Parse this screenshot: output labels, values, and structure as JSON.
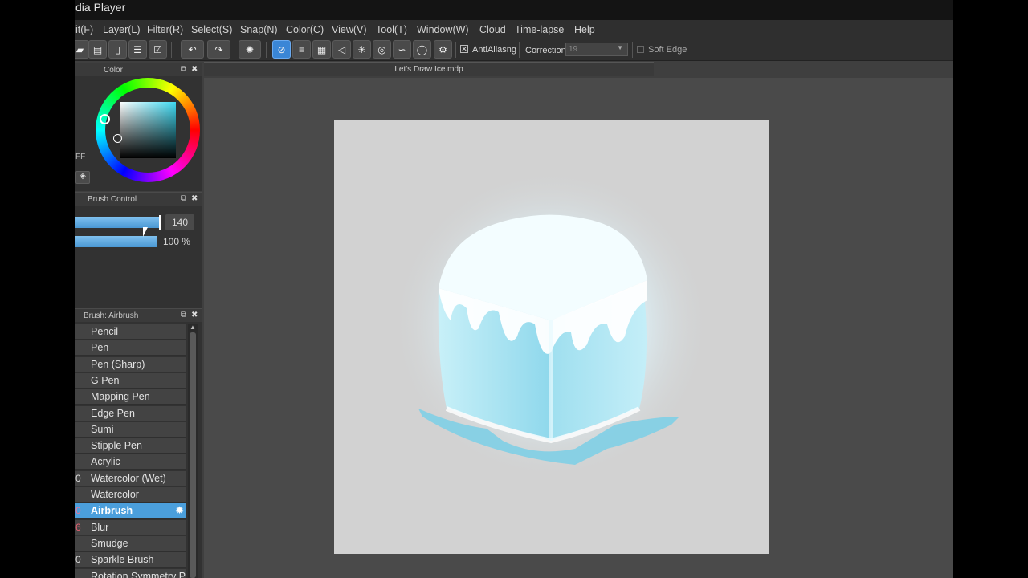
{
  "app": {
    "title": "dia Player"
  },
  "menu": [
    "it(F)",
    "Layer(L)",
    "Filter(R)",
    "Select(S)",
    "Snap(N)",
    "Color(C)",
    "View(V)",
    "Tool(T)",
    "Window(W)",
    "Cloud",
    "Time-lapse",
    "Help"
  ],
  "toolbar": {
    "antialias_label": "AntiAliasng",
    "correction_label": "Correction",
    "correction_value": "19",
    "soft_edge_label": "Soft Edge"
  },
  "color_panel": {
    "title": "Color",
    "hex_fragment": "FF"
  },
  "brush_control": {
    "title": "Brush Control",
    "size_value": "140",
    "opacity_value": "100 %",
    "size_fraction": 0.97,
    "opacity_fraction": 0.97
  },
  "brush_panel": {
    "title": "Brush: Airbrush",
    "items": [
      {
        "num": "",
        "name": "Pencil"
      },
      {
        "num": "",
        "name": "Pen"
      },
      {
        "num": "",
        "name": "Pen (Sharp)"
      },
      {
        "num": "",
        "name": "G Pen"
      },
      {
        "num": "",
        "name": "Mapping Pen"
      },
      {
        "num": "",
        "name": "Edge Pen"
      },
      {
        "num": "",
        "name": "Sumi"
      },
      {
        "num": "",
        "name": "Stipple Pen"
      },
      {
        "num": "",
        "name": "Acrylic"
      },
      {
        "num": "0",
        "name": "Watercolor (Wet)"
      },
      {
        "num": "",
        "name": "Watercolor"
      },
      {
        "num": "0",
        "name": "Airbrush"
      },
      {
        "num": "6",
        "name": "Blur"
      },
      {
        "num": "",
        "name": "Smudge"
      },
      {
        "num": "0",
        "name": "Sparkle Brush"
      },
      {
        "num": "",
        "name": "Rotation Symmetry P"
      }
    ],
    "selected": "Airbrush"
  },
  "document": {
    "tab_title": "Let's Draw Ice.mdp"
  },
  "colors": {
    "accent": "#4b9fdc",
    "canvas_bg": "#d2d2d2",
    "ice": "#a8e4f2"
  }
}
